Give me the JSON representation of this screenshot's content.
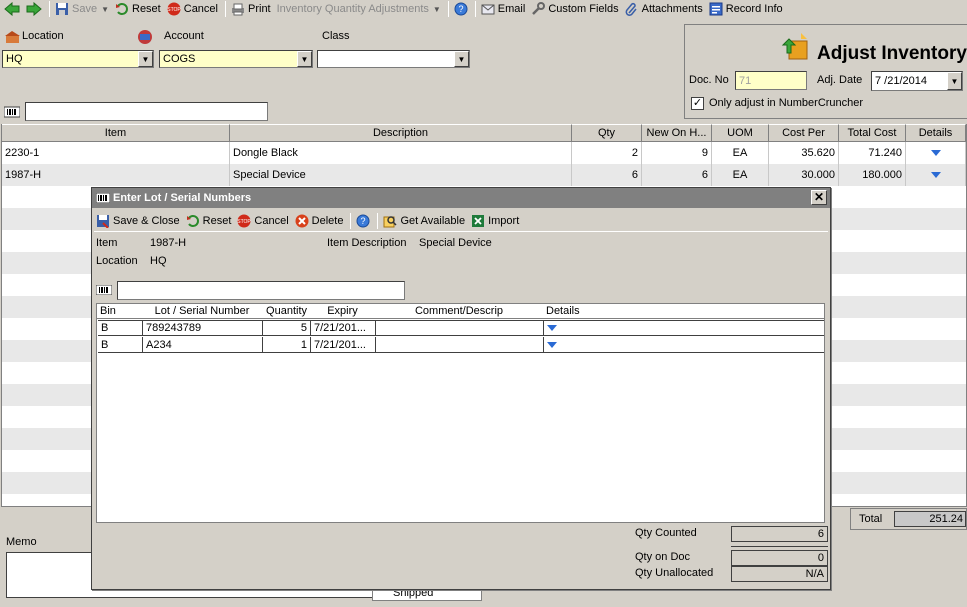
{
  "toolbar": {
    "save": "Save",
    "reset": "Reset",
    "cancel": "Cancel",
    "print": "Print",
    "template": "Inventory Quantity Adjustments",
    "email": "Email",
    "custom_fields": "Custom Fields",
    "attachments": "Attachments",
    "record_info": "Record Info"
  },
  "header": {
    "location_label": "Location",
    "location_value": "HQ",
    "account_label": "Account",
    "account_value": "COGS",
    "class_label": "Class",
    "class_value": ""
  },
  "panel": {
    "title": "Adjust Inventory",
    "doc_no_label": "Doc. No",
    "doc_no_value": "71",
    "adj_date_label": "Adj. Date",
    "adj_date_value": "7 /21/2014",
    "only_adjust_label": "Only adjust in NumberCruncher"
  },
  "grid": {
    "columns": [
      "Item",
      "Description",
      "Qty",
      "New On H...",
      "UOM",
      "Cost Per",
      "Total Cost",
      "Details"
    ],
    "rows": [
      {
        "item": "2230-1",
        "description": "Dongle Black",
        "qty": "2",
        "new_on_hand": "9",
        "uom": "EA",
        "cost_per": "35.620",
        "total_cost": "71.240"
      },
      {
        "item": "1987-H",
        "description": "Special Device",
        "qty": "6",
        "new_on_hand": "6",
        "uom": "EA",
        "cost_per": "30.000",
        "total_cost": "180.000"
      }
    ]
  },
  "footer": {
    "total_label": "Total",
    "total_value": "251.24",
    "memo_label": "Memo",
    "shipped_partial": "Shipped"
  },
  "dialog": {
    "title": "Enter Lot / Serial Numbers",
    "toolbar": {
      "save_close": "Save & Close",
      "reset": "Reset",
      "cancel": "Cancel",
      "delete": "Delete",
      "get_available": "Get Available",
      "import": "Import"
    },
    "item_label": "Item",
    "item_value": "1987-H",
    "item_desc_label": "Item Description",
    "item_desc_value": "Special Device",
    "location_label": "Location",
    "location_value": "HQ",
    "columns": [
      "Bin",
      "Lot / Serial Number",
      "Quantity",
      "Expiry",
      "Comment/Descrip",
      "Details"
    ],
    "rows": [
      {
        "bin": "B",
        "lot": "789243789",
        "quantity": "5",
        "expiry": "7/21/201...",
        "comment": ""
      },
      {
        "bin": "B",
        "lot": "A234",
        "quantity": "1",
        "expiry": "7/21/201...",
        "comment": ""
      }
    ],
    "qty_counted_label": "Qty Counted",
    "qty_counted_value": "6",
    "qty_on_doc_label": "Qty on Doc",
    "qty_on_doc_value": "0",
    "qty_unallocated_label": "Qty Unallocated",
    "qty_unallocated_value": "N/A"
  }
}
